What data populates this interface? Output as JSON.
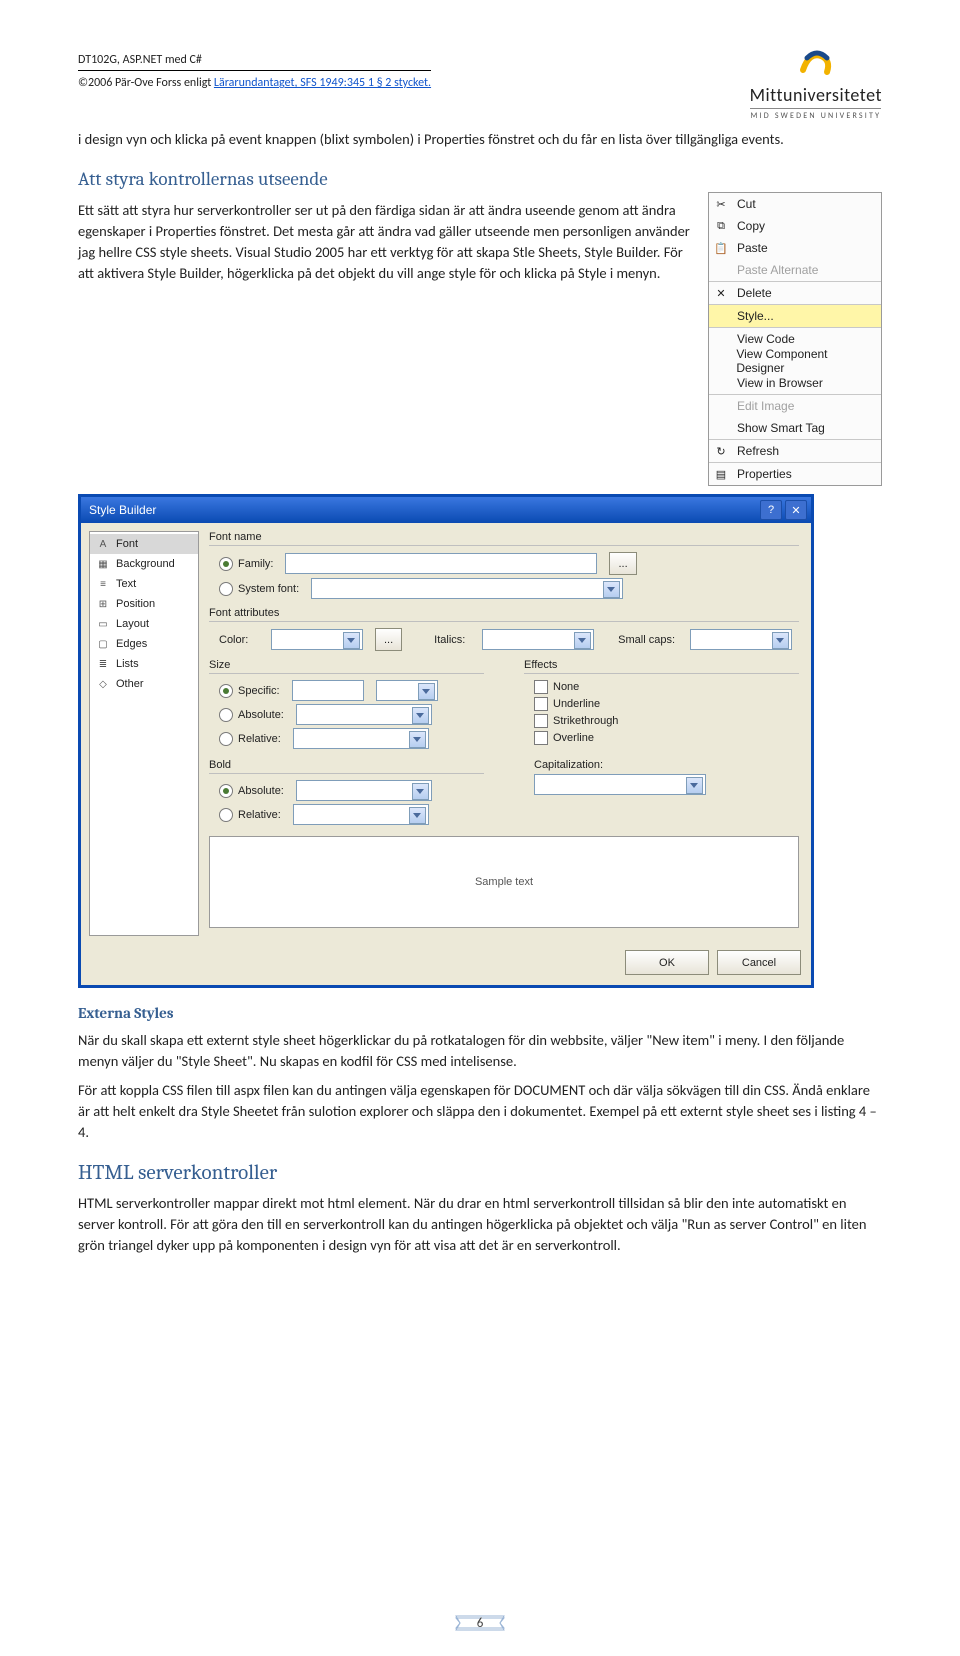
{
  "header": {
    "course": "DT102G, ASP.NET med C#",
    "copyright_pre": "©2006 Pär-Ove Forss enligt ",
    "copyright_link": "Lärarundantaget, SFS 1949:345 1 § 2 stycket.",
    "logo_name": "Mittuniversitetet",
    "logo_sub": "MID SWEDEN UNIVERSITY"
  },
  "para": {
    "intro": "i design vyn och klicka på event knappen (blixt symbolen) i Properties fönstret och du får en lista över tillgängliga events.",
    "h2_styra": "Att styra kontrollernas utseende",
    "styra_body": "Ett sätt att styra hur serverkontroller ser ut på den färdiga sidan är att ändra useende genom att ändra egenskaper i Properties fönstret. Det mesta går att ändra vad gäller utseende men personligen använder jag hellre CSS style sheets. Visual Studio 2005 har ett verktyg för att skapa Stle Sheets, Style Builder. För att aktivera Style Builder, högerklicka på det objekt du vill ange style för och klicka på Style i menyn.",
    "h3_ext": "Externa Styles",
    "ext1": "När du skall skapa ett externt style sheet högerklickar du på rotkatalogen för din webbsite, väljer \"New item\" i meny. I den följande menyn väljer du \"Style Sheet\". Nu skapas en kodfil för CSS med intelisense.",
    "ext2": "För att koppla CSS filen till aspx filen kan du antingen välja egenskapen för DOCUMENT och där välja sökvägen till din CSS. Ändå enklare är att helt enkelt dra Style Sheetet från sulotion explorer och släppa den i dokumentet. Exempel på ett externt style sheet ses i listing 4 – 4.",
    "h1_html": "HTML serverkontroller",
    "html_body": "HTML serverkontroller mappar direkt mot html element. När du drar en html serverkontroll tillsidan så blir den inte automatiskt en server kontroll. För att göra den till en serverkontroll kan du antingen högerklicka på objektet och välja \"Run as server Control\" en liten grön triangel dyker upp på komponenten i design vyn för att visa att det är en serverkontroll."
  },
  "context_menu": {
    "items": [
      {
        "icon": "cut",
        "label": "Cut",
        "enabled": true
      },
      {
        "icon": "copy",
        "label": "Copy",
        "enabled": true
      },
      {
        "icon": "paste",
        "label": "Paste",
        "enabled": true
      },
      {
        "icon": "",
        "label": "Paste Alternate",
        "enabled": false
      },
      {
        "icon": "delete",
        "label": "Delete",
        "enabled": true,
        "sep": true
      },
      {
        "icon": "",
        "label": "Style...",
        "enabled": true,
        "hl": true,
        "sep": true
      },
      {
        "icon": "",
        "label": "View Code",
        "enabled": true,
        "sep": true
      },
      {
        "icon": "",
        "label": "View Component Designer",
        "enabled": true
      },
      {
        "icon": "",
        "label": "View in Browser",
        "enabled": true
      },
      {
        "icon": "",
        "label": "Edit Image",
        "enabled": false,
        "sep": true
      },
      {
        "icon": "",
        "label": "Show Smart Tag",
        "enabled": true
      },
      {
        "icon": "refresh",
        "label": "Refresh",
        "enabled": true,
        "sep": true
      },
      {
        "icon": "props",
        "label": "Properties",
        "enabled": true,
        "sep": true
      }
    ]
  },
  "style_builder": {
    "title": "Style Builder",
    "nav": [
      "Font",
      "Background",
      "Text",
      "Position",
      "Layout",
      "Edges",
      "Lists",
      "Other"
    ],
    "labels": {
      "font_name": "Font name",
      "family": "Family:",
      "system_font": "System font:",
      "font_attr": "Font attributes",
      "color": "Color:",
      "italics": "Italics:",
      "small_caps": "Small caps:",
      "size": "Size",
      "effects": "Effects",
      "specific": "Specific:",
      "absolute": "Absolute:",
      "relative": "Relative:",
      "none": "None",
      "underline": "Underline",
      "strike": "Strikethrough",
      "overline": "Overline",
      "bold": "Bold",
      "cap": "Capitalization:",
      "sample": "Sample text",
      "ok": "OK",
      "cancel": "Cancel",
      "dots": "..."
    }
  },
  "page_number": "6"
}
